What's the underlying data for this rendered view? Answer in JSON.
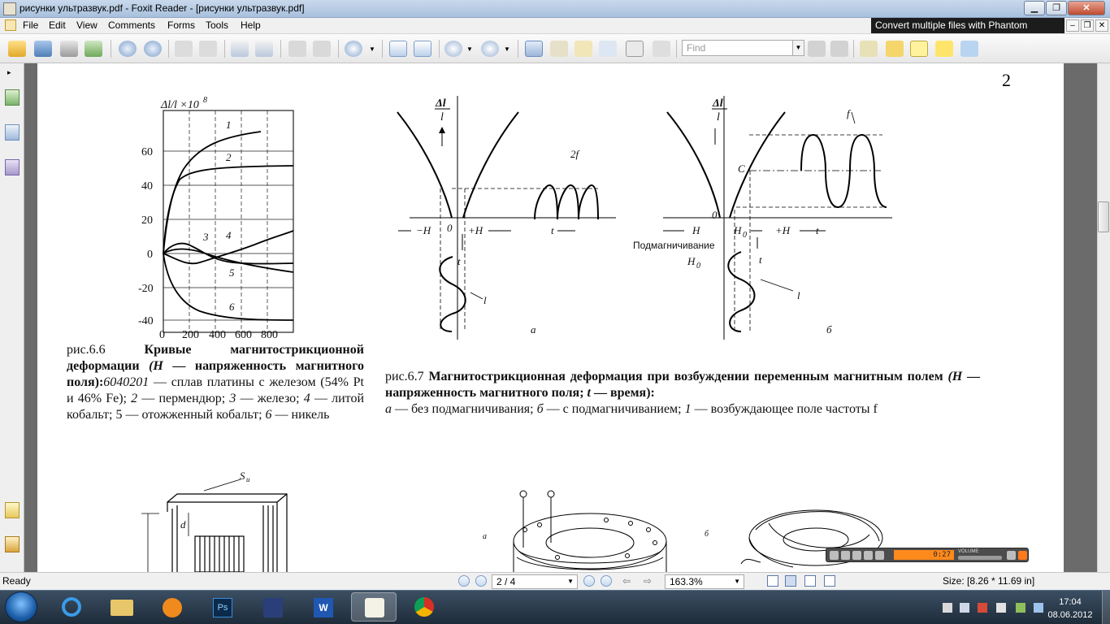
{
  "window": {
    "title": "рисунки ультразвук.pdf - Foxit Reader - [рисунки ультразвук.pdf]"
  },
  "menu": {
    "items": [
      "File",
      "Edit",
      "View",
      "Comments",
      "Forms",
      "Tools",
      "Help"
    ]
  },
  "banner": {
    "text": "Convert multiple files with Phantom"
  },
  "toolbar": {
    "find_placeholder": "Find"
  },
  "document": {
    "page_number": "2",
    "fig66": {
      "y_axis_label": "Δl/l ×10",
      "y_axis_exp": "8",
      "y_ticks": [
        "60",
        "40",
        "20",
        "0",
        "-20",
        "-40"
      ],
      "x_ticks": [
        "0",
        "200",
        "400",
        "600",
        "800"
      ],
      "curve_labels": [
        "1",
        "2",
        "3",
        "4",
        "5",
        "6"
      ],
      "caption": {
        "prefix": "рис.6.6 ",
        "bold1": "Кривые магнитострикционной деформации ",
        "bold_italic": "(H",
        "bold2": " — напряженность магнитного поля):",
        "italic_nums": "6040201",
        "rest1": " — сплав платины с железом (54% Pt и 46% Fe); ",
        "n2": "2",
        "rest2": " — пермендюр; ",
        "n3": "3",
        "rest3": " — железо; ",
        "n4": "4",
        "rest4": " — литой кобальт; 5 — отожженный кобальт; ",
        "n6": "6",
        "rest5": " — никель"
      }
    },
    "fig67": {
      "a": {
        "y_label_top": "Δl",
        "y_label_bottom": "l",
        "origin": "0",
        "neg_h": "−H",
        "pos_h": "+H",
        "t_axis": "t",
        "t_vert": "t",
        "freq": "2f",
        "curve": "l",
        "sub": "а"
      },
      "b": {
        "y_label_top": "Δl",
        "y_label_bottom": "l",
        "origin": "0",
        "neg_h": "H",
        "h0": "H",
        "h0_sub": "0",
        "pos_h": "+H",
        "c_label": "C",
        "t_axis": "t",
        "t_vert": "t",
        "freq": "f",
        "curve": "l",
        "bias_label": "Подмагничивание",
        "bias_h": "H",
        "bias_h_sub": "0",
        "sub": "б"
      },
      "caption": {
        "prefix": "рис.6.7 ",
        "bold1": "Магнитострикционная деформация при возбуждении переменным магнитным полем ",
        "bold_italic1": "(H",
        "bold2": " — напряженность магнитного поля; ",
        "bold_italic2": "t",
        "bold3": " — время):",
        "a_letter": "а",
        "text_a": " — без подмагничивания; ",
        "b_letter": "б",
        "text_b": " — с подмагничиванием; ",
        "n1": "1",
        "text_c": " — возбуждающее поле частоты f"
      }
    },
    "fig_bottom": {
      "su_label": "S",
      "su_sub": "u",
      "d_label": "d",
      "a_label": "a",
      "b_label": "б"
    }
  },
  "media": {
    "time": "0:27",
    "volume_label": "VOLUME"
  },
  "status": {
    "ready": "Ready",
    "page": "2 / 4",
    "zoom": "163.3%",
    "size": "Size: [8.26 * 11.69 in]"
  },
  "taskbar": {
    "time": "17:04",
    "date": "08.06.2012"
  },
  "colors": {
    "title_bar": "#b6cbe4",
    "phantom_banner": "#1c1c1c",
    "media_time": "#ff8a1c",
    "taskbar": "#2c3d4f"
  }
}
